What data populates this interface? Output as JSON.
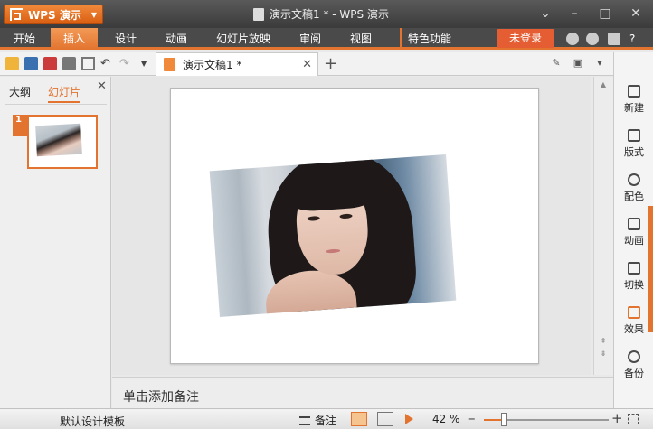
{
  "app": {
    "button_label": "WPS 演示",
    "window_title": "演示文稿1 * - WPS 演示"
  },
  "menu": {
    "tabs": [
      {
        "label": "开始"
      },
      {
        "label": "插入"
      },
      {
        "label": "设计"
      },
      {
        "label": "动画"
      },
      {
        "label": "幻灯片放映"
      },
      {
        "label": "审阅"
      },
      {
        "label": "视图"
      }
    ],
    "active_tab": "插入",
    "feature_label": "特色功能",
    "login_label": "未登录"
  },
  "document_tab": {
    "title": "演示文稿1 *"
  },
  "left_panel": {
    "tab_outline": "大纲",
    "tab_slides": "幻灯片",
    "active": "幻灯片",
    "slides": [
      {
        "number": "1"
      }
    ]
  },
  "notes": {
    "placeholder": "单击添加备注"
  },
  "right_pane": {
    "items": [
      {
        "label": "新建",
        "icon": "new-icon"
      },
      {
        "label": "版式",
        "icon": "layout-icon"
      },
      {
        "label": "配色",
        "icon": "palette-icon"
      },
      {
        "label": "动画",
        "icon": "animation-icon"
      },
      {
        "label": "切换",
        "icon": "transition-icon"
      },
      {
        "label": "效果",
        "icon": "effects-icon"
      },
      {
        "label": "备份",
        "icon": "backup-icon"
      }
    ]
  },
  "status_bar": {
    "template_label": "默认设计模板",
    "notes_label": "备注",
    "zoom_label": "42 %",
    "zoom_percent": 42
  },
  "colors": {
    "accent": "#e2742f",
    "title_bar": "#4a4a4a",
    "login": "#e55d32"
  }
}
